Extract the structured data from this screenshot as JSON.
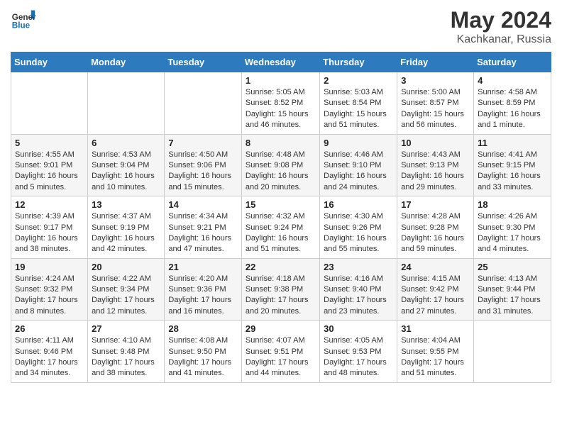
{
  "header": {
    "logo_line1": "General",
    "logo_line2": "Blue",
    "month_year": "May 2024",
    "location": "Kachkanar, Russia"
  },
  "days_of_week": [
    "Sunday",
    "Monday",
    "Tuesday",
    "Wednesday",
    "Thursday",
    "Friday",
    "Saturday"
  ],
  "weeks": [
    [
      {
        "day": "",
        "info": ""
      },
      {
        "day": "",
        "info": ""
      },
      {
        "day": "",
        "info": ""
      },
      {
        "day": "1",
        "info": "Sunrise: 5:05 AM\nSunset: 8:52 PM\nDaylight: 15 hours and 46 minutes."
      },
      {
        "day": "2",
        "info": "Sunrise: 5:03 AM\nSunset: 8:54 PM\nDaylight: 15 hours and 51 minutes."
      },
      {
        "day": "3",
        "info": "Sunrise: 5:00 AM\nSunset: 8:57 PM\nDaylight: 15 hours and 56 minutes."
      },
      {
        "day": "4",
        "info": "Sunrise: 4:58 AM\nSunset: 8:59 PM\nDaylight: 16 hours and 1 minute."
      }
    ],
    [
      {
        "day": "5",
        "info": "Sunrise: 4:55 AM\nSunset: 9:01 PM\nDaylight: 16 hours and 5 minutes."
      },
      {
        "day": "6",
        "info": "Sunrise: 4:53 AM\nSunset: 9:04 PM\nDaylight: 16 hours and 10 minutes."
      },
      {
        "day": "7",
        "info": "Sunrise: 4:50 AM\nSunset: 9:06 PM\nDaylight: 16 hours and 15 minutes."
      },
      {
        "day": "8",
        "info": "Sunrise: 4:48 AM\nSunset: 9:08 PM\nDaylight: 16 hours and 20 minutes."
      },
      {
        "day": "9",
        "info": "Sunrise: 4:46 AM\nSunset: 9:10 PM\nDaylight: 16 hours and 24 minutes."
      },
      {
        "day": "10",
        "info": "Sunrise: 4:43 AM\nSunset: 9:13 PM\nDaylight: 16 hours and 29 minutes."
      },
      {
        "day": "11",
        "info": "Sunrise: 4:41 AM\nSunset: 9:15 PM\nDaylight: 16 hours and 33 minutes."
      }
    ],
    [
      {
        "day": "12",
        "info": "Sunrise: 4:39 AM\nSunset: 9:17 PM\nDaylight: 16 hours and 38 minutes."
      },
      {
        "day": "13",
        "info": "Sunrise: 4:37 AM\nSunset: 9:19 PM\nDaylight: 16 hours and 42 minutes."
      },
      {
        "day": "14",
        "info": "Sunrise: 4:34 AM\nSunset: 9:21 PM\nDaylight: 16 hours and 47 minutes."
      },
      {
        "day": "15",
        "info": "Sunrise: 4:32 AM\nSunset: 9:24 PM\nDaylight: 16 hours and 51 minutes."
      },
      {
        "day": "16",
        "info": "Sunrise: 4:30 AM\nSunset: 9:26 PM\nDaylight: 16 hours and 55 minutes."
      },
      {
        "day": "17",
        "info": "Sunrise: 4:28 AM\nSunset: 9:28 PM\nDaylight: 16 hours and 59 minutes."
      },
      {
        "day": "18",
        "info": "Sunrise: 4:26 AM\nSunset: 9:30 PM\nDaylight: 17 hours and 4 minutes."
      }
    ],
    [
      {
        "day": "19",
        "info": "Sunrise: 4:24 AM\nSunset: 9:32 PM\nDaylight: 17 hours and 8 minutes."
      },
      {
        "day": "20",
        "info": "Sunrise: 4:22 AM\nSunset: 9:34 PM\nDaylight: 17 hours and 12 minutes."
      },
      {
        "day": "21",
        "info": "Sunrise: 4:20 AM\nSunset: 9:36 PM\nDaylight: 17 hours and 16 minutes."
      },
      {
        "day": "22",
        "info": "Sunrise: 4:18 AM\nSunset: 9:38 PM\nDaylight: 17 hours and 20 minutes."
      },
      {
        "day": "23",
        "info": "Sunrise: 4:16 AM\nSunset: 9:40 PM\nDaylight: 17 hours and 23 minutes."
      },
      {
        "day": "24",
        "info": "Sunrise: 4:15 AM\nSunset: 9:42 PM\nDaylight: 17 hours and 27 minutes."
      },
      {
        "day": "25",
        "info": "Sunrise: 4:13 AM\nSunset: 9:44 PM\nDaylight: 17 hours and 31 minutes."
      }
    ],
    [
      {
        "day": "26",
        "info": "Sunrise: 4:11 AM\nSunset: 9:46 PM\nDaylight: 17 hours and 34 minutes."
      },
      {
        "day": "27",
        "info": "Sunrise: 4:10 AM\nSunset: 9:48 PM\nDaylight: 17 hours and 38 minutes."
      },
      {
        "day": "28",
        "info": "Sunrise: 4:08 AM\nSunset: 9:50 PM\nDaylight: 17 hours and 41 minutes."
      },
      {
        "day": "29",
        "info": "Sunrise: 4:07 AM\nSunset: 9:51 PM\nDaylight: 17 hours and 44 minutes."
      },
      {
        "day": "30",
        "info": "Sunrise: 4:05 AM\nSunset: 9:53 PM\nDaylight: 17 hours and 48 minutes."
      },
      {
        "day": "31",
        "info": "Sunrise: 4:04 AM\nSunset: 9:55 PM\nDaylight: 17 hours and 51 minutes."
      },
      {
        "day": "",
        "info": ""
      }
    ]
  ]
}
